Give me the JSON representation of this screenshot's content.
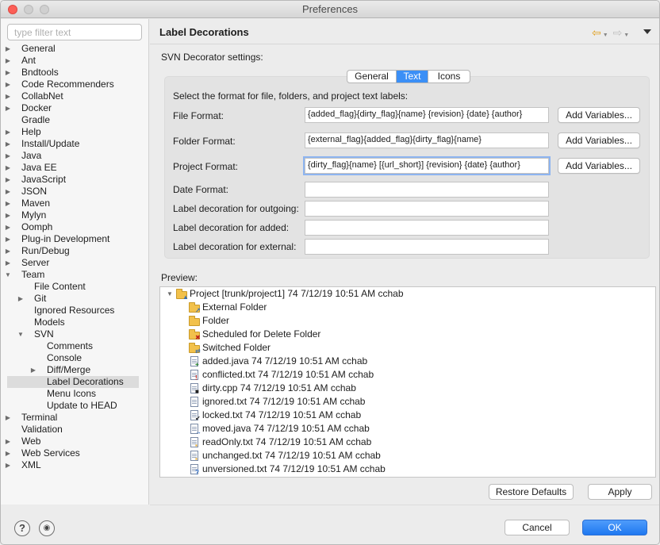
{
  "window": {
    "title": "Preferences"
  },
  "sidebar": {
    "filter_placeholder": "type filter text",
    "items": [
      {
        "label": "General",
        "level": 0,
        "twisty": "closed"
      },
      {
        "label": "Ant",
        "level": 0,
        "twisty": "closed"
      },
      {
        "label": "Bndtools",
        "level": 0,
        "twisty": "closed"
      },
      {
        "label": "Code Recommenders",
        "level": 0,
        "twisty": "closed"
      },
      {
        "label": "CollabNet",
        "level": 0,
        "twisty": "closed"
      },
      {
        "label": "Docker",
        "level": 0,
        "twisty": "closed"
      },
      {
        "label": "Gradle",
        "level": 0,
        "twisty": "none"
      },
      {
        "label": "Help",
        "level": 0,
        "twisty": "closed"
      },
      {
        "label": "Install/Update",
        "level": 0,
        "twisty": "closed"
      },
      {
        "label": "Java",
        "level": 0,
        "twisty": "closed"
      },
      {
        "label": "Java EE",
        "level": 0,
        "twisty": "closed"
      },
      {
        "label": "JavaScript",
        "level": 0,
        "twisty": "closed"
      },
      {
        "label": "JSON",
        "level": 0,
        "twisty": "closed"
      },
      {
        "label": "Maven",
        "level": 0,
        "twisty": "closed"
      },
      {
        "label": "Mylyn",
        "level": 0,
        "twisty": "closed"
      },
      {
        "label": "Oomph",
        "level": 0,
        "twisty": "closed"
      },
      {
        "label": "Plug-in Development",
        "level": 0,
        "twisty": "closed"
      },
      {
        "label": "Run/Debug",
        "level": 0,
        "twisty": "closed"
      },
      {
        "label": "Server",
        "level": 0,
        "twisty": "closed"
      },
      {
        "label": "Team",
        "level": 0,
        "twisty": "open"
      },
      {
        "label": "File Content",
        "level": 1,
        "twisty": "none"
      },
      {
        "label": "Git",
        "level": 1,
        "twisty": "closed"
      },
      {
        "label": "Ignored Resources",
        "level": 1,
        "twisty": "none"
      },
      {
        "label": "Models",
        "level": 1,
        "twisty": "none"
      },
      {
        "label": "SVN",
        "level": 1,
        "twisty": "open"
      },
      {
        "label": "Comments",
        "level": 2,
        "twisty": "none"
      },
      {
        "label": "Console",
        "level": 2,
        "twisty": "none"
      },
      {
        "label": "Diff/Merge",
        "level": 2,
        "twisty": "closed"
      },
      {
        "label": "Label Decorations",
        "level": 2,
        "twisty": "none",
        "selected": true
      },
      {
        "label": "Menu Icons",
        "level": 2,
        "twisty": "none"
      },
      {
        "label": "Update to HEAD",
        "level": 2,
        "twisty": "none"
      },
      {
        "label": "Terminal",
        "level": 0,
        "twisty": "closed"
      },
      {
        "label": "Validation",
        "level": 0,
        "twisty": "none"
      },
      {
        "label": "Web",
        "level": 0,
        "twisty": "closed"
      },
      {
        "label": "Web Services",
        "level": 0,
        "twisty": "closed"
      },
      {
        "label": "XML",
        "level": 0,
        "twisty": "closed"
      }
    ]
  },
  "page": {
    "title": "Label Decorations",
    "nav_icons": [
      "back-arrow-icon",
      "forward-arrow-icon",
      "view-menu-icon"
    ],
    "settings_label": "SVN Decorator settings:",
    "tabs": [
      {
        "label": "General",
        "active": false
      },
      {
        "label": "Text",
        "active": true
      },
      {
        "label": "Icons",
        "active": false
      }
    ],
    "select_label": "Select the format for file, folders, and project text labels:",
    "fields": [
      {
        "name": "file-format",
        "label": "File Format:",
        "value": "{added_flag}{dirty_flag}{name} {revision}  {date}  {author}",
        "button": "Add Variables..."
      },
      {
        "name": "folder-format",
        "label": "Folder Format:",
        "value": "{external_flag}{added_flag}{dirty_flag}{name}",
        "button": "Add Variables..."
      },
      {
        "name": "project-format",
        "label": "Project Format:",
        "value": "{dirty_flag}{name} [{url_short}] {revision}  {date}  {author}",
        "button": "Add Variables...",
        "focused": true
      },
      {
        "name": "date-format",
        "label": "Date Format:",
        "value": ""
      },
      {
        "name": "outgoing-decoration",
        "label": "Label decoration for outgoing:",
        "value": ""
      },
      {
        "name": "added-decoration",
        "label": "Label decoration for added:",
        "value": ""
      },
      {
        "name": "external-decoration",
        "label": "Label decoration for external:",
        "value": ""
      }
    ],
    "preview_label": "Preview:",
    "preview": {
      "project": "Project [trunk/project1] 74  7/12/19 10:51 AM  cchab",
      "items": [
        {
          "label": "External Folder",
          "kind": "folder",
          "overlay": "external"
        },
        {
          "label": "Folder",
          "kind": "folder",
          "overlay": "none"
        },
        {
          "label": "Scheduled for Delete Folder",
          "kind": "folder",
          "overlay": "deleted"
        },
        {
          "label": "Switched Folder",
          "kind": "folder",
          "overlay": "switched"
        },
        {
          "label": "added.java 74  7/12/19 10:51 AM  cchab",
          "kind": "file",
          "overlay": "added"
        },
        {
          "label": "conflicted.txt 74  7/12/19 10:51 AM  cchab",
          "kind": "file",
          "overlay": "conflicted"
        },
        {
          "label": "dirty.cpp 74  7/12/19 10:51 AM  cchab",
          "kind": "file",
          "overlay": "dirty"
        },
        {
          "label": "ignored.txt 74  7/12/19 10:51 AM  cchab",
          "kind": "file",
          "overlay": "none"
        },
        {
          "label": "locked.txt 74  7/12/19 10:51 AM  cchab",
          "kind": "file",
          "overlay": "locked"
        },
        {
          "label": "moved.java 74  7/12/19 10:51 AM  cchab",
          "kind": "file",
          "overlay": "moved"
        },
        {
          "label": "readOnly.txt 74  7/12/19 10:51 AM  cchab",
          "kind": "file",
          "overlay": "readonly"
        },
        {
          "label": "unchanged.txt 74  7/12/19 10:51 AM  cchab",
          "kind": "file",
          "overlay": "unchanged"
        },
        {
          "label": "unversioned.txt 74  7/12/19 10:51 AM  cchab",
          "kind": "file",
          "overlay": "unversioned"
        }
      ]
    },
    "restore_defaults": "Restore Defaults",
    "apply": "Apply"
  },
  "footer": {
    "help_icon": "help-icon",
    "import_icon": "import-export-icon",
    "cancel": "Cancel",
    "ok": "OK"
  },
  "colors": {
    "accent": "#3b8ff6",
    "selection": "#dcdcdc",
    "folder": "#f2c14b"
  }
}
